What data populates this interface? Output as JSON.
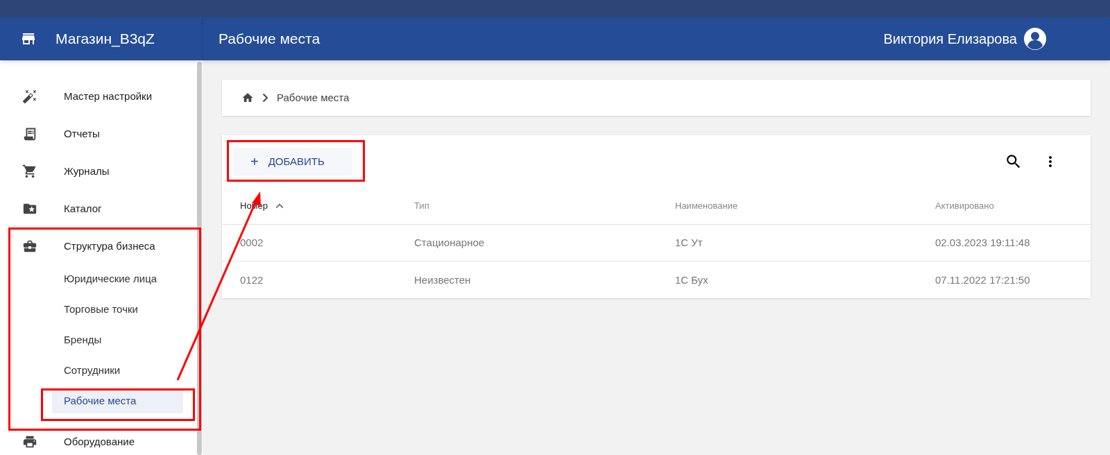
{
  "header": {
    "shop_name": "Магазин_B3qZ",
    "page_title": "Рабочие места",
    "user_name": "Виктория Елизарова"
  },
  "sidebar": {
    "items": [
      {
        "label": "Мастер настройки",
        "selected": false
      },
      {
        "label": "Отчеты",
        "selected": false
      },
      {
        "label": "Журналы",
        "selected": false
      },
      {
        "label": "Каталог",
        "selected": false
      },
      {
        "label": "Структура бизнеса",
        "selected": false,
        "expanded": true,
        "children": [
          {
            "label": "Юридические лица",
            "selected": false
          },
          {
            "label": "Торговые точки",
            "selected": false
          },
          {
            "label": "Бренды",
            "selected": false
          },
          {
            "label": "Сотрудники",
            "selected": false
          },
          {
            "label": "Рабочие места",
            "selected": true
          }
        ]
      },
      {
        "label": "Оборудование",
        "selected": false
      }
    ]
  },
  "breadcrumb": {
    "items": [
      "Рабочие места"
    ]
  },
  "toolbar": {
    "add_button": "ДОБАВИТЬ",
    "plus": "+"
  },
  "table": {
    "columns": [
      {
        "label": "Номер",
        "sorted": true
      },
      {
        "label": "Тип",
        "sorted": false
      },
      {
        "label": "Наименование",
        "sorted": false
      },
      {
        "label": "Активировано",
        "sorted": false
      }
    ],
    "rows": [
      [
        "0002",
        "Стационарное",
        "1С Ут",
        "02.03.2023 19:11:48"
      ],
      [
        "0122",
        "Неизвестен",
        "1С Бух",
        "07.11.2022 17:21:50"
      ]
    ]
  }
}
